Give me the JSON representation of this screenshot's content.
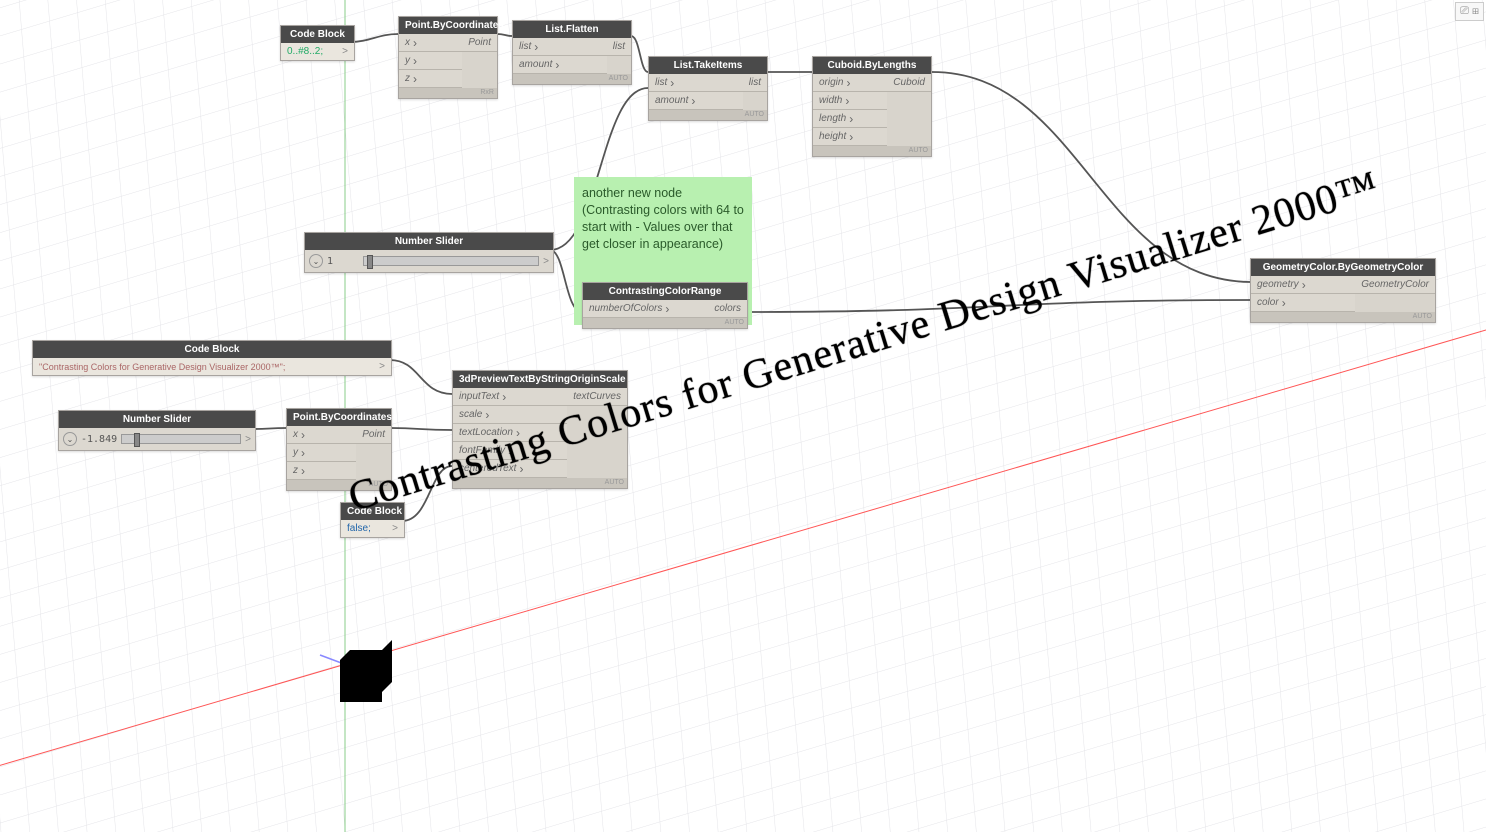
{
  "annotation": "another new node (Contrasting colors with 64 to start with - Values over that get closer in appearance)",
  "viewport_text": "Contrasting Colors for Generative Design Visualizer 2000™",
  "top_icons": "⎚ ⊞",
  "footer_auto": "AUTO",
  "footer_rxr": "RxR",
  "nodes": {
    "cb1": {
      "title": "Code Block",
      "code": "0..#8..2;",
      "chev": ">"
    },
    "point1": {
      "title": "Point.ByCoordinates",
      "in": [
        "x",
        "y",
        "z"
      ],
      "out": "Point"
    },
    "flatten": {
      "title": "List.Flatten",
      "in": [
        "list",
        "amount"
      ],
      "out": "list"
    },
    "take": {
      "title": "List.TakeItems",
      "in": [
        "list",
        "amount"
      ],
      "out": "list"
    },
    "cuboid": {
      "title": "Cuboid.ByLengths",
      "in": [
        "origin",
        "width",
        "length",
        "height"
      ],
      "out": "Cuboid"
    },
    "slider1": {
      "title": "Number Slider",
      "val": "1",
      "chev": ">"
    },
    "ccr": {
      "title": "ContrastingColorRange",
      "in": [
        "numberOfColors"
      ],
      "out": "colors"
    },
    "geocolor": {
      "title": "GeometryColor.ByGeometryColor",
      "in": [
        "geometry",
        "color"
      ],
      "out": "GeometryColor"
    },
    "cb2": {
      "title": "Code Block",
      "code": "\"Contrasting Colors for Generative Design Visualizer 2000™\";",
      "chev": ">"
    },
    "slider2": {
      "title": "Number Slider",
      "val": "-1.849",
      "chev": ">"
    },
    "point2": {
      "title": "Point.ByCoordinates",
      "in": [
        "x",
        "y",
        "z"
      ],
      "out": "Point"
    },
    "preview3d": {
      "title": "3dPreviewTextByStringOriginScale",
      "in": [
        "inputText",
        "scale",
        "textLocation",
        "fontFamily",
        "centeredText"
      ],
      "out": "textCurves"
    },
    "cb3": {
      "title": "Code Block",
      "code": "false;",
      "chev": ">"
    }
  }
}
